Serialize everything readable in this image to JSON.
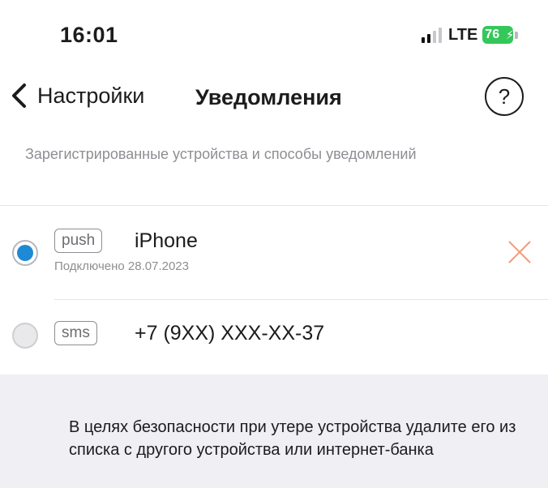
{
  "status_bar": {
    "time": "16:01",
    "network": "LTE",
    "battery_level": "76",
    "battery_color": "#34c759",
    "icons": [
      "signal-icon",
      "battery-icon",
      "charging-bolt-icon"
    ]
  },
  "nav": {
    "back_label": "Настройки",
    "title": "Уведомления",
    "help_label": "?",
    "icons": [
      "chevron-left-icon"
    ]
  },
  "section": {
    "header": "Зарегистрированные устройства и способы уведомлений"
  },
  "devices": [
    {
      "selected": true,
      "type_tag": "push",
      "name": "iPhone",
      "subtitle": "Подключено 28.07.2023",
      "removable": true
    },
    {
      "selected": false,
      "type_tag": "sms",
      "name": "+7 (9XX) XXX-XX-37",
      "subtitle": "",
      "removable": false
    }
  ],
  "info": {
    "text": "В целях безопасности при утере устройства удалите его из списка с другого устройства или интернет-банка"
  },
  "colors": {
    "accent": "#1e8ad6",
    "remove": "#f29a78",
    "muted_text": "#8e8e93",
    "panel_bg": "#efeff4"
  }
}
